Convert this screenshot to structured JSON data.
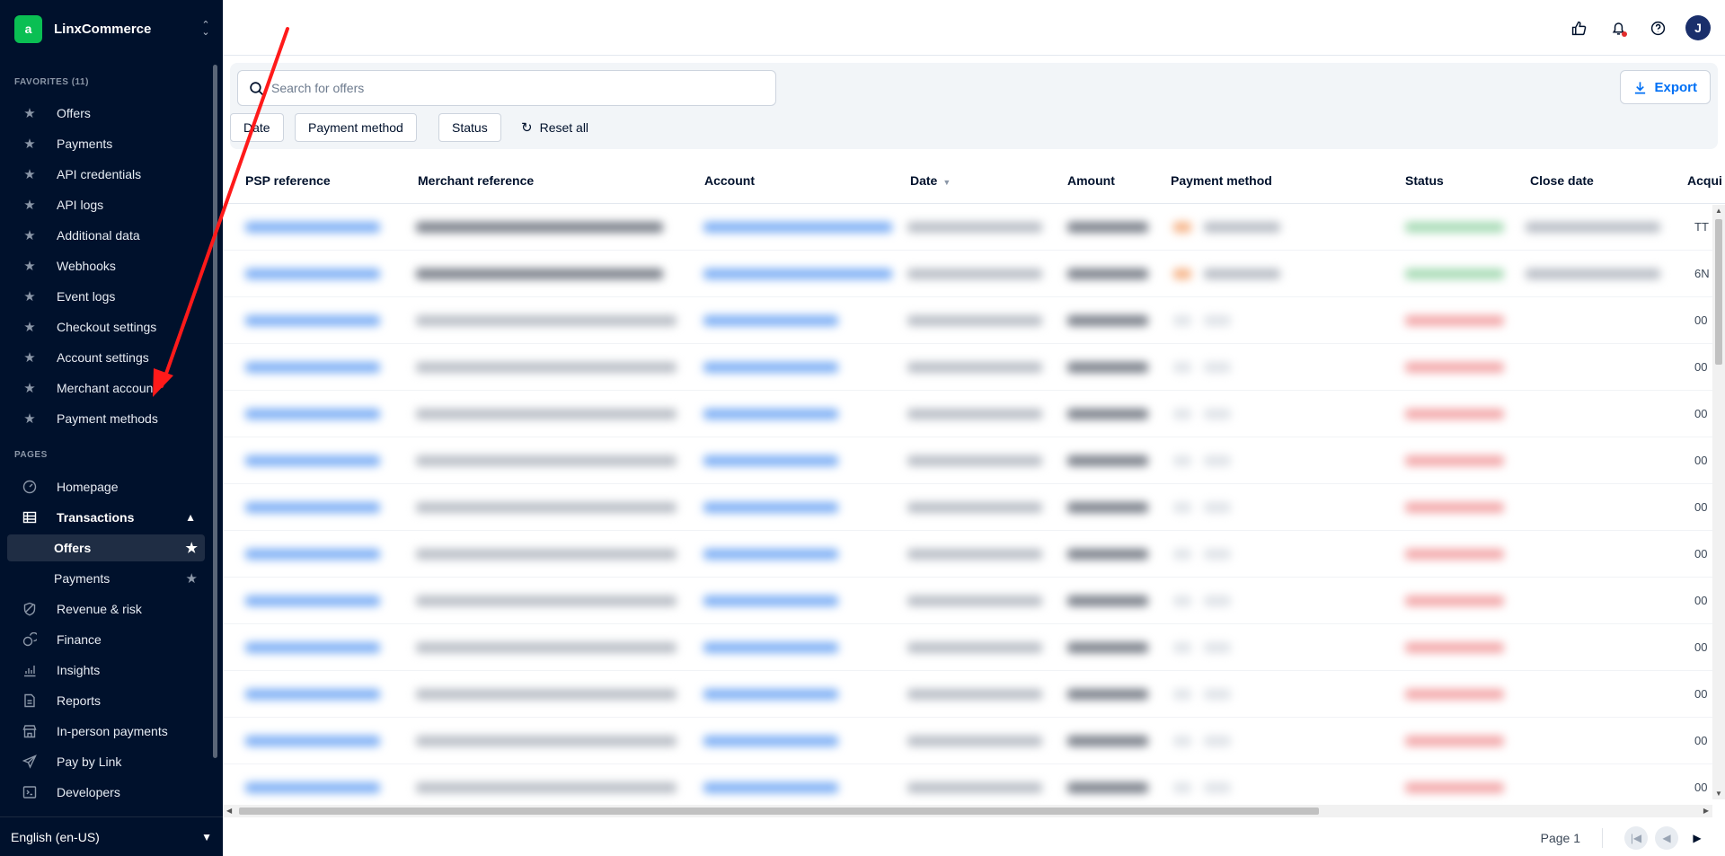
{
  "brand": {
    "name": "LinxCommerce",
    "logo_letter": "a"
  },
  "sidebar": {
    "favorites_label": "FAVORITES (11)",
    "favorites": [
      {
        "label": "Offers"
      },
      {
        "label": "Payments"
      },
      {
        "label": "API credentials"
      },
      {
        "label": "API logs"
      },
      {
        "label": "Additional data"
      },
      {
        "label": "Webhooks"
      },
      {
        "label": "Event logs"
      },
      {
        "label": "Checkout settings"
      },
      {
        "label": "Account settings"
      },
      {
        "label": "Merchant account"
      },
      {
        "label": "Payment methods"
      }
    ],
    "pages_label": "PAGES",
    "pages": [
      {
        "label": "Homepage",
        "icon": "gauge-icon"
      },
      {
        "label": "Transactions",
        "icon": "table-icon",
        "expanded": true
      },
      {
        "label": "Offers",
        "sub": true,
        "active": true,
        "starred": true
      },
      {
        "label": "Payments",
        "sub": true,
        "starred": true
      },
      {
        "label": "Revenue & risk",
        "icon": "shield-icon"
      },
      {
        "label": "Finance",
        "icon": "coins-icon"
      },
      {
        "label": "Insights",
        "icon": "bar-chart-icon"
      },
      {
        "label": "Reports",
        "icon": "document-icon"
      },
      {
        "label": "In-person payments",
        "icon": "store-icon"
      },
      {
        "label": "Pay by Link",
        "icon": "paper-plane-icon"
      },
      {
        "label": "Developers",
        "icon": "code-icon"
      }
    ],
    "language": "English (en-US)"
  },
  "topbar": {
    "icons": [
      "thumbs-up-icon",
      "bell-icon",
      "help-icon"
    ],
    "avatar_initial": "J"
  },
  "filters": {
    "search_placeholder": "Search for offers",
    "chips": [
      "Date",
      "Payment method",
      "Status"
    ],
    "reset_label": "Reset all",
    "export_label": "Export"
  },
  "table": {
    "columns": [
      "PSP reference",
      "Merchant reference",
      "Account",
      "Date",
      "Amount",
      "Payment method",
      "Status",
      "Close date",
      "Acqui"
    ],
    "sorted_column": "Date",
    "edge_values": [
      "TT",
      "6N",
      "00",
      "00",
      "00",
      "00",
      "00",
      "00",
      "00",
      "00",
      "00",
      "00",
      "00"
    ]
  },
  "pagination": {
    "label": "Page 1"
  },
  "colors": {
    "sidebar_bg": "#00112c",
    "accent": "#0070f5",
    "brand_green": "#0abf53",
    "annotation_arrow": "#ff1a1a"
  }
}
